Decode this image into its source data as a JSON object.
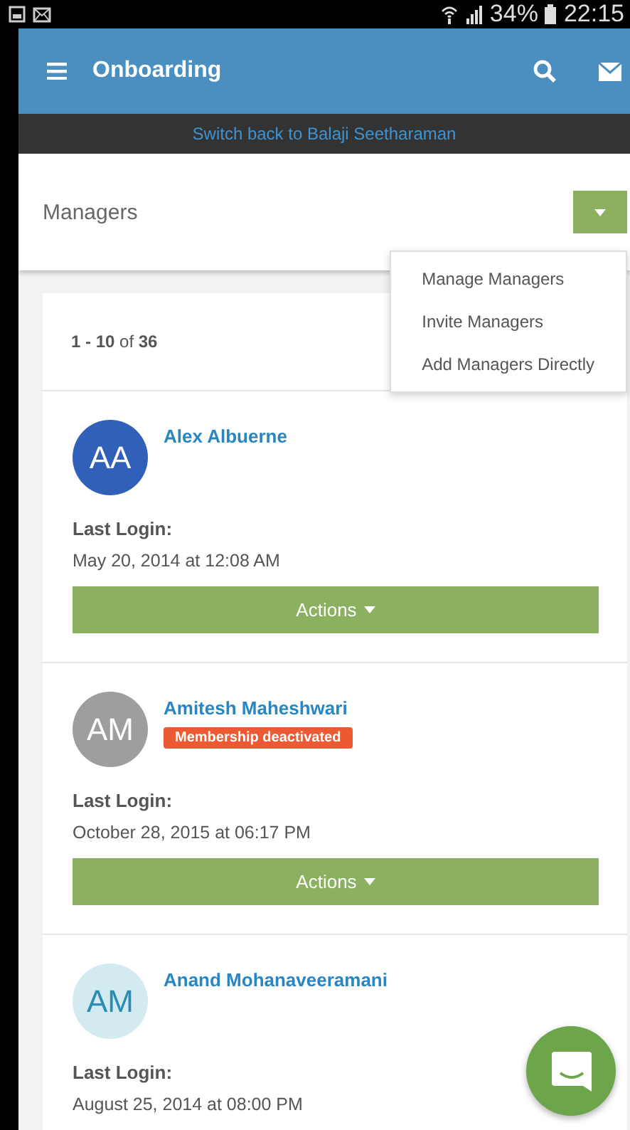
{
  "status_bar": {
    "battery": "34%",
    "time": "22:15"
  },
  "header": {
    "title": "Onboarding"
  },
  "switch_link": "Switch back to Balaji Seetharaman",
  "page": {
    "title": "Managers"
  },
  "menu": {
    "items": [
      "Manage Managers",
      "Invite Managers",
      "Add Managers Directly"
    ]
  },
  "pagination": "**1 - 10** of **36**",
  "managers": [
    {
      "initials": "AA",
      "color": "#3060b8",
      "name": "Alex Albuerne",
      "deactivated": false,
      "login_label": "Last Login:",
      "login": "May 20, 2014 at 12:08 AM",
      "action": "Actions"
    },
    {
      "initials": "AM",
      "color": "#9e9e9e",
      "name": "Amitesh Maheshwari",
      "deactivated": true,
      "badge": "Membership deactivated",
      "login_label": "Last Login:",
      "login": "October 28, 2015 at 06:17 PM",
      "action": "Actions"
    },
    {
      "initials": "AM",
      "color": "#d2eaf0",
      "name": "Anand Mohanaveeramani",
      "deactivated": false,
      "login_label": "Last Login:",
      "login": "August 25, 2014 at 08:00 PM"
    }
  ]
}
